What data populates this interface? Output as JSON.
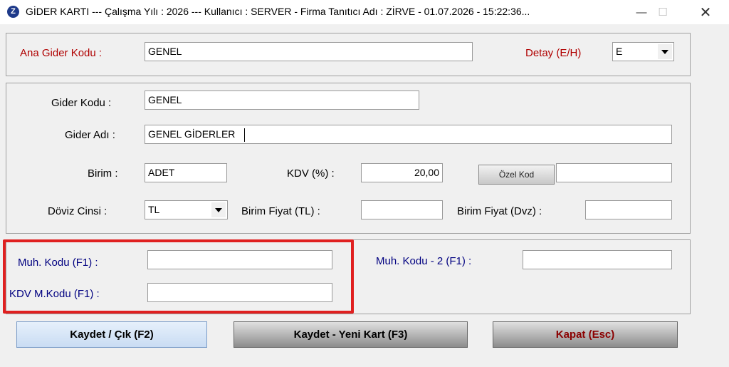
{
  "window": {
    "title": "GİDER KARTI  ---  Çalışma Yılı : 2026  ---  Kullanıcı : SERVER - Firma Tanıtıcı Adı : ZİRVE - 01.07.2026 - 15:22:36...",
    "app_icon_letter": "Z",
    "minimize": "—",
    "maximize": "☐",
    "close": "✕"
  },
  "header_panel": {
    "ana_gider_kodu_label": "Ana Gider Kodu :",
    "ana_gider_kodu_value": "GENEL",
    "detay_label": "Detay (E/H)",
    "detay_value": "E"
  },
  "main_panel": {
    "gider_kodu_label": "Gider Kodu :",
    "gider_kodu_value": "GENEL",
    "gider_adi_label": "Gider Adı :",
    "gider_adi_value": "GENEL GİDERLER",
    "birim_label": "Birim :",
    "birim_value": "ADET",
    "kdv_label": "KDV (%) :",
    "kdv_value": "20,00",
    "ozel_kod_button": "Özel Kod",
    "ozel_kod_value": "",
    "doviz_cinsi_label": "Döviz Cinsi :",
    "doviz_cinsi_value": "TL",
    "birim_fiyat_tl_label": "Birim Fiyat (TL) :",
    "birim_fiyat_tl_value": "",
    "birim_fiyat_dvz_label": "Birim Fiyat (Dvz) :",
    "birim_fiyat_dvz_value": ""
  },
  "accounting_panel": {
    "muh_kodu_label": "Muh. Kodu (F1) :",
    "muh_kodu_value": "",
    "kdv_mkodu_label": "KDV M.Kodu (F1) :",
    "kdv_mkodu_value": "",
    "muh_kodu2_label": "Muh. Kodu - 2 (F1) :",
    "muh_kodu2_value": ""
  },
  "buttons": {
    "save_exit": "Kaydet / Çık (F2)",
    "save_new": "Kaydet - Yeni Kart (F3)",
    "close": "Kapat (Esc)"
  },
  "colors": {
    "highlight": "#e02020",
    "label_red": "#b00000",
    "label_blue": "#000080"
  }
}
